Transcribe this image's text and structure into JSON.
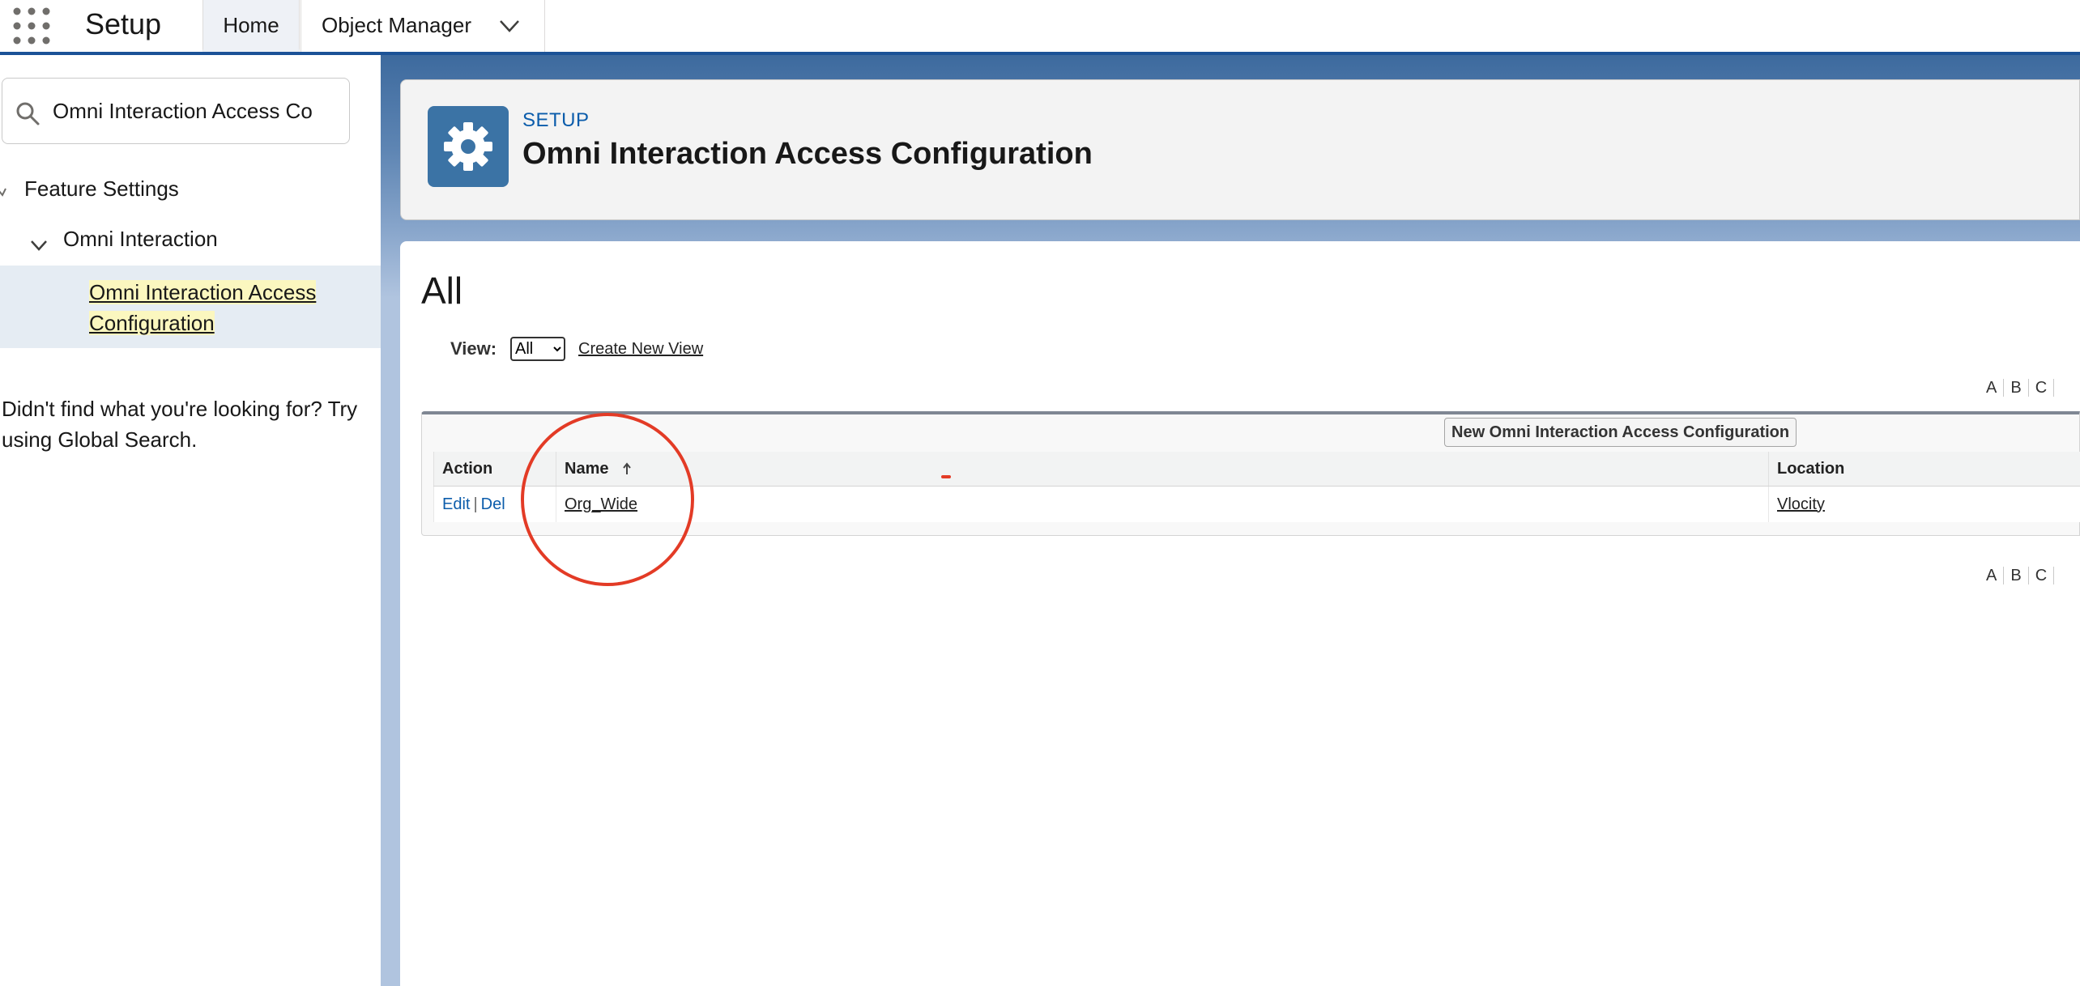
{
  "topbar": {
    "app_title": "Setup",
    "tabs": [
      {
        "label": "Home"
      },
      {
        "label": "Object Manager"
      }
    ]
  },
  "sidebar": {
    "search_value": "Omni Interaction Access Co",
    "tree": {
      "feature_settings": "Feature Settings",
      "omni_interaction": "Omni Interaction",
      "selected_item": "Omni Interaction Access Configuration"
    },
    "help_text": "Didn't find what you're looking for? Try using Global Search."
  },
  "header": {
    "eyebrow": "SETUP",
    "title": "Omni Interaction Access Configuration"
  },
  "list_view": {
    "heading": "All",
    "view_label": "View:",
    "view_selected": "All",
    "create_new_view": "Create New View",
    "alphabet": [
      "A",
      "B",
      "C"
    ],
    "new_button": "New Omni Interaction Access Configuration",
    "columns": [
      "Action",
      "Name",
      "Location"
    ],
    "rows": [
      {
        "edit": "Edit",
        "sep": "|",
        "del": "Del",
        "name": "Org_Wide",
        "location": "Vlocity"
      }
    ]
  },
  "colors": {
    "brand": "#1b5297",
    "header_icon": "#3b73a5",
    "link_blue": "#0b5cab",
    "annotation": "#e33b26",
    "highlight": "#fbf7bf"
  }
}
